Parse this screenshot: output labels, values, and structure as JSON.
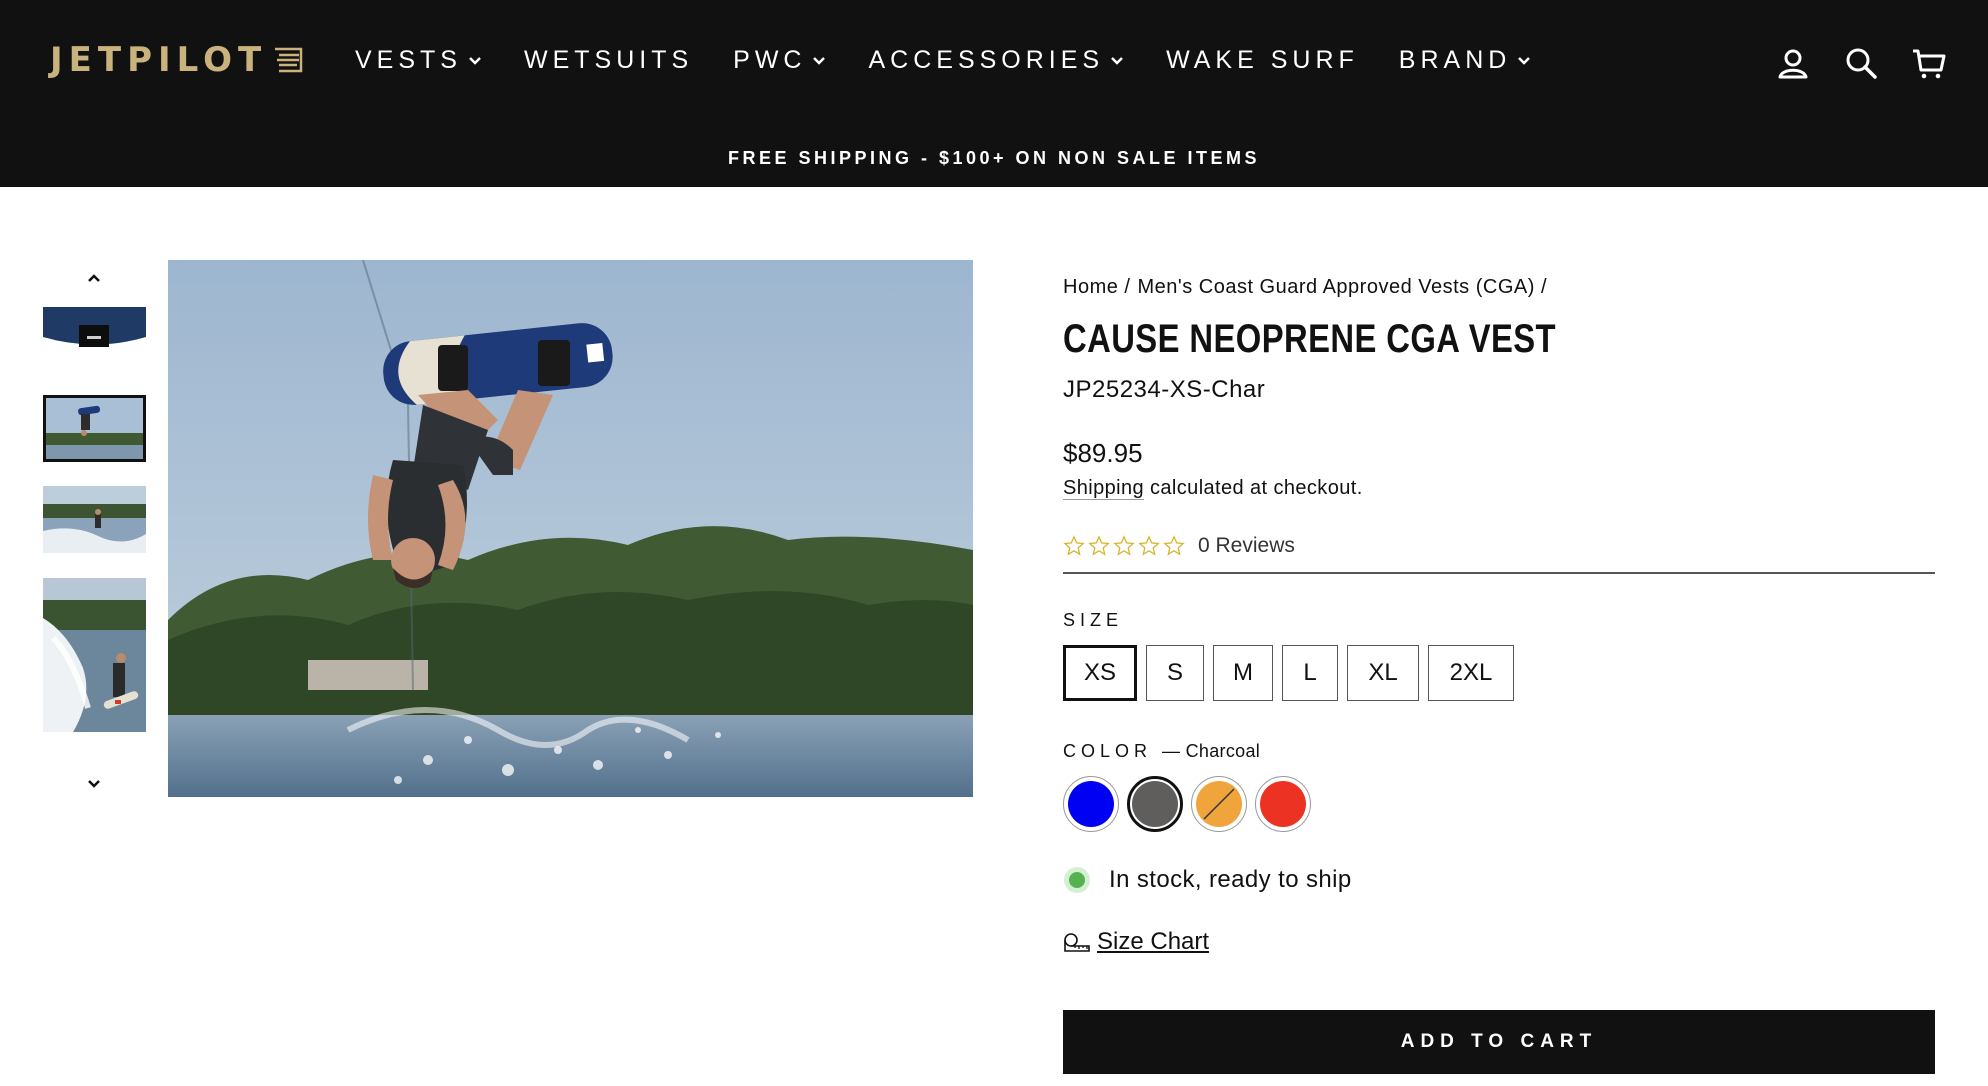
{
  "brand": {
    "logo_text": "JETPILOT",
    "logo_color": "#c9b27c"
  },
  "nav": {
    "items": [
      {
        "label": "VESTS",
        "has_dropdown": true
      },
      {
        "label": "WETSUITS",
        "has_dropdown": false
      },
      {
        "label": "PWC",
        "has_dropdown": true
      },
      {
        "label": "ACCESSORIES",
        "has_dropdown": true
      },
      {
        "label": "WAKE SURF",
        "has_dropdown": false
      },
      {
        "label": "BRAND",
        "has_dropdown": true
      }
    ],
    "icons": [
      "account-icon",
      "search-icon",
      "cart-icon"
    ]
  },
  "banner": {
    "text": "FREE SHIPPING - $100+ ON NON SALE ITEMS"
  },
  "gallery": {
    "thumbnails": [
      "vest-detail",
      "wakeboard-flip",
      "rider-wake",
      "wake-spray"
    ],
    "active_thumbnail": 1
  },
  "product": {
    "breadcrumb": [
      "Home /",
      "Men's Coast Guard Approved Vests (CGA) /"
    ],
    "title": "CAUSE NEOPRENE CGA VEST",
    "sku": "JP25234-XS-Char",
    "price": "$89.95",
    "shipping_link": "Shipping",
    "shipping_rest": " calculated at checkout.",
    "rating_stars": 0,
    "reviews_label": "0 Reviews",
    "size_label": "SIZE",
    "sizes": [
      "XS",
      "S",
      "M",
      "L",
      "XL",
      "2XL"
    ],
    "selected_size": "XS",
    "color_label": "COLOR",
    "color_value": "— Charcoal",
    "colors": [
      {
        "name": "blue",
        "hex": "#0000f2",
        "available": true
      },
      {
        "name": "charcoal",
        "hex": "#5f5e5d",
        "available": true,
        "selected": true
      },
      {
        "name": "orange",
        "hex": "#f0a53c",
        "available": false
      },
      {
        "name": "red",
        "hex": "#ec3323",
        "available": true
      }
    ],
    "stock_text": "In stock, ready to ship",
    "stock_color": "#56b14f",
    "size_chart_label": "Size Chart",
    "add_to_cart_label": "ADD TO CART"
  }
}
